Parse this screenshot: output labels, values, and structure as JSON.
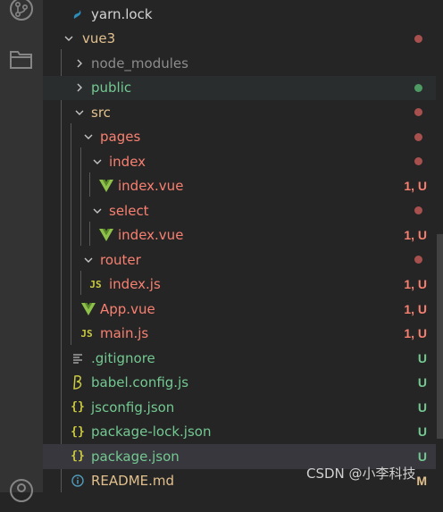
{
  "colors": {
    "modified": "#e2c08d",
    "folder_modified": "#e2c08d",
    "untracked": "#73c991",
    "error_red": "#f14c4c",
    "public_green": "#73c991",
    "ignored": "#8c8c8c",
    "dot_red": "#a8504d",
    "dot_green": "#4e9a63"
  },
  "icons": {
    "activity_top": "source-control-icon",
    "activity_files": "files-icon",
    "activity_bottom": "account-icon"
  },
  "tree": [
    {
      "label": "yarn.lock",
      "icon": "yarn-icon",
      "status": "",
      "dot": ""
    },
    {
      "label": "vue3",
      "icon": "chevron-down-icon",
      "status": "",
      "dot": "red"
    },
    {
      "label": "node_modules",
      "icon": "chevron-right-icon",
      "status": "",
      "dot": ""
    },
    {
      "label": "public",
      "icon": "chevron-right-icon",
      "status": "",
      "dot": "green"
    },
    {
      "label": "src",
      "icon": "chevron-down-icon",
      "status": "",
      "dot": "red"
    },
    {
      "label": "pages",
      "icon": "chevron-down-icon",
      "status": "",
      "dot": "red"
    },
    {
      "label": "index",
      "icon": "chevron-down-icon",
      "status": "",
      "dot": "red"
    },
    {
      "label": "index.vue",
      "icon": "vue-icon",
      "status": "1, U",
      "dot": ""
    },
    {
      "label": "select",
      "icon": "chevron-down-icon",
      "status": "",
      "dot": "red"
    },
    {
      "label": "index.vue",
      "icon": "vue-icon",
      "status": "1, U",
      "dot": ""
    },
    {
      "label": "router",
      "icon": "chevron-down-icon",
      "status": "",
      "dot": "red"
    },
    {
      "label": "index.js",
      "icon": "js-icon",
      "status": "1, U",
      "dot": ""
    },
    {
      "label": "App.vue",
      "icon": "vue-icon",
      "status": "1, U",
      "dot": ""
    },
    {
      "label": "main.js",
      "icon": "js-icon",
      "status": "1, U",
      "dot": ""
    },
    {
      "label": ".gitignore",
      "icon": "lines-icon",
      "status": "U",
      "dot": ""
    },
    {
      "label": "babel.config.js",
      "icon": "babel-icon",
      "status": "U",
      "dot": ""
    },
    {
      "label": "jsconfig.json",
      "icon": "json-icon",
      "status": "U",
      "dot": ""
    },
    {
      "label": "package-lock.json",
      "icon": "json-icon",
      "status": "U",
      "dot": ""
    },
    {
      "label": "package.json",
      "icon": "json-icon",
      "status": "U",
      "dot": ""
    },
    {
      "label": "README.md",
      "icon": "info-icon",
      "status": "M",
      "dot": ""
    }
  ],
  "watermark": "CSDN @小李科技"
}
